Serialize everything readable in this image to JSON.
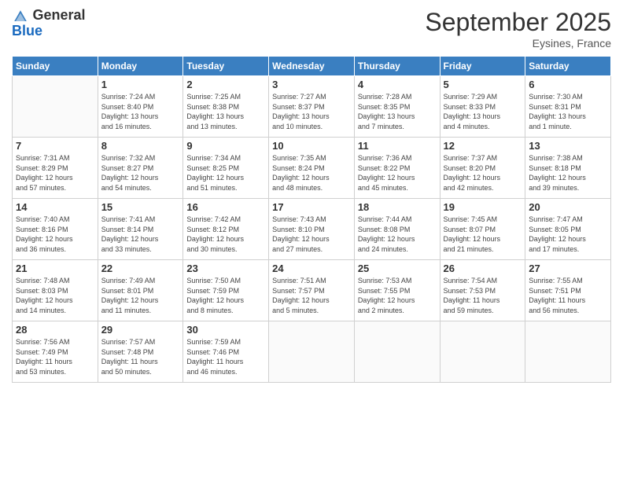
{
  "logo": {
    "line1": "General",
    "line2": "Blue"
  },
  "title": "September 2025",
  "location": "Eysines, France",
  "days_of_week": [
    "Sunday",
    "Monday",
    "Tuesday",
    "Wednesday",
    "Thursday",
    "Friday",
    "Saturday"
  ],
  "weeks": [
    [
      {
        "day": "",
        "info": ""
      },
      {
        "day": "1",
        "info": "Sunrise: 7:24 AM\nSunset: 8:40 PM\nDaylight: 13 hours\nand 16 minutes."
      },
      {
        "day": "2",
        "info": "Sunrise: 7:25 AM\nSunset: 8:38 PM\nDaylight: 13 hours\nand 13 minutes."
      },
      {
        "day": "3",
        "info": "Sunrise: 7:27 AM\nSunset: 8:37 PM\nDaylight: 13 hours\nand 10 minutes."
      },
      {
        "day": "4",
        "info": "Sunrise: 7:28 AM\nSunset: 8:35 PM\nDaylight: 13 hours\nand 7 minutes."
      },
      {
        "day": "5",
        "info": "Sunrise: 7:29 AM\nSunset: 8:33 PM\nDaylight: 13 hours\nand 4 minutes."
      },
      {
        "day": "6",
        "info": "Sunrise: 7:30 AM\nSunset: 8:31 PM\nDaylight: 13 hours\nand 1 minute."
      }
    ],
    [
      {
        "day": "7",
        "info": "Sunrise: 7:31 AM\nSunset: 8:29 PM\nDaylight: 12 hours\nand 57 minutes."
      },
      {
        "day": "8",
        "info": "Sunrise: 7:32 AM\nSunset: 8:27 PM\nDaylight: 12 hours\nand 54 minutes."
      },
      {
        "day": "9",
        "info": "Sunrise: 7:34 AM\nSunset: 8:25 PM\nDaylight: 12 hours\nand 51 minutes."
      },
      {
        "day": "10",
        "info": "Sunrise: 7:35 AM\nSunset: 8:24 PM\nDaylight: 12 hours\nand 48 minutes."
      },
      {
        "day": "11",
        "info": "Sunrise: 7:36 AM\nSunset: 8:22 PM\nDaylight: 12 hours\nand 45 minutes."
      },
      {
        "day": "12",
        "info": "Sunrise: 7:37 AM\nSunset: 8:20 PM\nDaylight: 12 hours\nand 42 minutes."
      },
      {
        "day": "13",
        "info": "Sunrise: 7:38 AM\nSunset: 8:18 PM\nDaylight: 12 hours\nand 39 minutes."
      }
    ],
    [
      {
        "day": "14",
        "info": "Sunrise: 7:40 AM\nSunset: 8:16 PM\nDaylight: 12 hours\nand 36 minutes."
      },
      {
        "day": "15",
        "info": "Sunrise: 7:41 AM\nSunset: 8:14 PM\nDaylight: 12 hours\nand 33 minutes."
      },
      {
        "day": "16",
        "info": "Sunrise: 7:42 AM\nSunset: 8:12 PM\nDaylight: 12 hours\nand 30 minutes."
      },
      {
        "day": "17",
        "info": "Sunrise: 7:43 AM\nSunset: 8:10 PM\nDaylight: 12 hours\nand 27 minutes."
      },
      {
        "day": "18",
        "info": "Sunrise: 7:44 AM\nSunset: 8:08 PM\nDaylight: 12 hours\nand 24 minutes."
      },
      {
        "day": "19",
        "info": "Sunrise: 7:45 AM\nSunset: 8:07 PM\nDaylight: 12 hours\nand 21 minutes."
      },
      {
        "day": "20",
        "info": "Sunrise: 7:47 AM\nSunset: 8:05 PM\nDaylight: 12 hours\nand 17 minutes."
      }
    ],
    [
      {
        "day": "21",
        "info": "Sunrise: 7:48 AM\nSunset: 8:03 PM\nDaylight: 12 hours\nand 14 minutes."
      },
      {
        "day": "22",
        "info": "Sunrise: 7:49 AM\nSunset: 8:01 PM\nDaylight: 12 hours\nand 11 minutes."
      },
      {
        "day": "23",
        "info": "Sunrise: 7:50 AM\nSunset: 7:59 PM\nDaylight: 12 hours\nand 8 minutes."
      },
      {
        "day": "24",
        "info": "Sunrise: 7:51 AM\nSunset: 7:57 PM\nDaylight: 12 hours\nand 5 minutes."
      },
      {
        "day": "25",
        "info": "Sunrise: 7:53 AM\nSunset: 7:55 PM\nDaylight: 12 hours\nand 2 minutes."
      },
      {
        "day": "26",
        "info": "Sunrise: 7:54 AM\nSunset: 7:53 PM\nDaylight: 11 hours\nand 59 minutes."
      },
      {
        "day": "27",
        "info": "Sunrise: 7:55 AM\nSunset: 7:51 PM\nDaylight: 11 hours\nand 56 minutes."
      }
    ],
    [
      {
        "day": "28",
        "info": "Sunrise: 7:56 AM\nSunset: 7:49 PM\nDaylight: 11 hours\nand 53 minutes."
      },
      {
        "day": "29",
        "info": "Sunrise: 7:57 AM\nSunset: 7:48 PM\nDaylight: 11 hours\nand 50 minutes."
      },
      {
        "day": "30",
        "info": "Sunrise: 7:59 AM\nSunset: 7:46 PM\nDaylight: 11 hours\nand 46 minutes."
      },
      {
        "day": "",
        "info": ""
      },
      {
        "day": "",
        "info": ""
      },
      {
        "day": "",
        "info": ""
      },
      {
        "day": "",
        "info": ""
      }
    ]
  ]
}
